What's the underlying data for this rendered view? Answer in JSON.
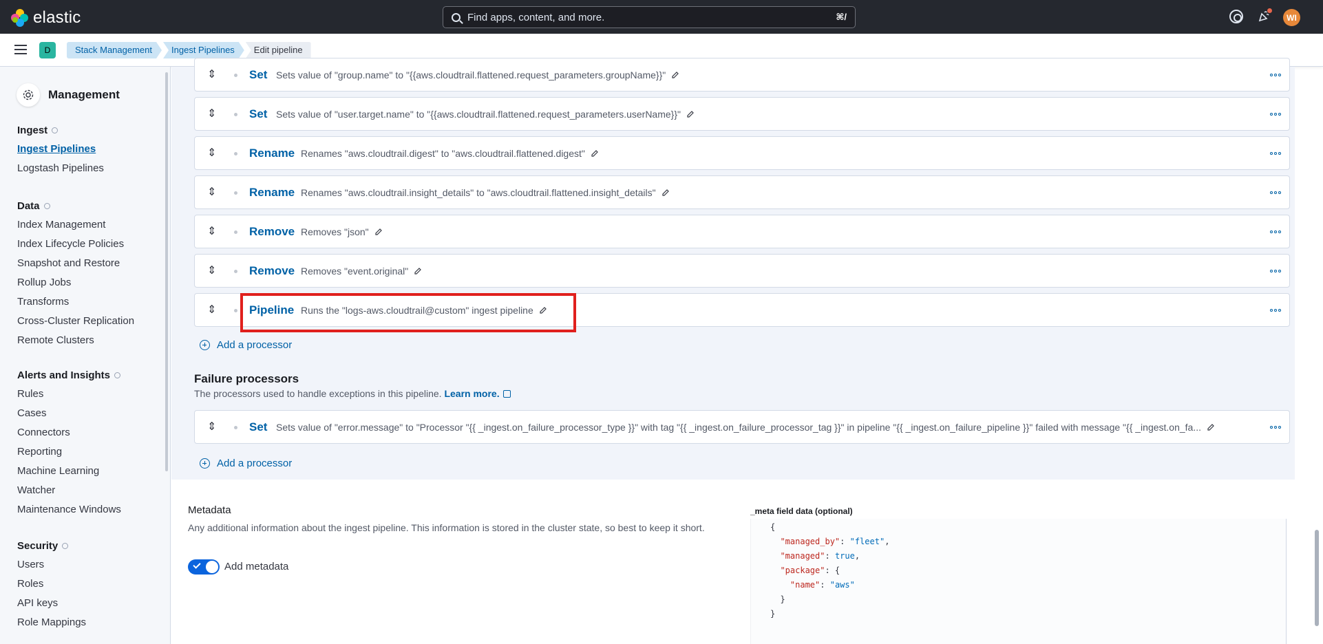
{
  "header": {
    "brand": "elastic",
    "search_placeholder": "Find apps, content, and more.",
    "search_shortcut": "⌘/",
    "avatar_initials": "WI"
  },
  "subheader": {
    "space_initial": "D",
    "breadcrumbs": [
      "Stack Management",
      "Ingest Pipelines",
      "Edit pipeline"
    ]
  },
  "sidebar": {
    "title": "Management",
    "groups": [
      {
        "title": "Ingest",
        "items": [
          "Ingest Pipelines",
          "Logstash Pipelines"
        ]
      },
      {
        "title": "Data",
        "items": [
          "Index Management",
          "Index Lifecycle Policies",
          "Snapshot and Restore",
          "Rollup Jobs",
          "Transforms",
          "Cross-Cluster Replication",
          "Remote Clusters"
        ]
      },
      {
        "title": "Alerts and Insights",
        "items": [
          "Rules",
          "Cases",
          "Connectors",
          "Reporting",
          "Machine Learning",
          "Watcher",
          "Maintenance Windows"
        ]
      },
      {
        "title": "Security",
        "items": [
          "Users",
          "Roles",
          "API keys",
          "Role Mappings"
        ]
      }
    ]
  },
  "processors": [
    {
      "type": "Set",
      "desc": "Sets value of \"group.name\" to \"{{aws.cloudtrail.flattened.request_parameters.groupName}}\""
    },
    {
      "type": "Set",
      "desc": "Sets value of \"user.target.name\" to \"{{aws.cloudtrail.flattened.request_parameters.userName}}\""
    },
    {
      "type": "Rename",
      "desc": "Renames \"aws.cloudtrail.digest\" to \"aws.cloudtrail.flattened.digest\""
    },
    {
      "type": "Rename",
      "desc": "Renames \"aws.cloudtrail.insight_details\" to \"aws.cloudtrail.flattened.insight_details\""
    },
    {
      "type": "Remove",
      "desc": "Removes \"json\""
    },
    {
      "type": "Remove",
      "desc": "Removes \"event.original\""
    },
    {
      "type": "Pipeline",
      "desc": "Runs the \"logs-aws.cloudtrail@custom\" ingest pipeline"
    }
  ],
  "add_processor_label": "Add a processor",
  "failure": {
    "title": "Failure processors",
    "description": "The processors used to handle exceptions in this pipeline.",
    "learn_more": "Learn more.",
    "processor": {
      "type": "Set",
      "desc": "Sets value of \"error.message\" to \"Processor \"{{ _ingest.on_failure_processor_type }}\" with tag \"{{ _ingest.on_failure_processor_tag }}\" in pipeline \"{{ _ingest.on_failure_pipeline }}\" failed with message \"{{ _ingest.on_fa..."
    }
  },
  "metadata": {
    "title": "Metadata",
    "description": "Any additional information about the ingest pipeline. This information is stored in the cluster state, so best to keep it short.",
    "toggle_label": "Add metadata",
    "toggle_on": true,
    "field_label": "_meta field data (optional)",
    "code": {
      "open": "{",
      "managed_by_key": "\"managed_by\"",
      "managed_by_val": "\"fleet\"",
      "managed_key": "\"managed\"",
      "managed_val": "true",
      "package_key": "\"package\"",
      "name_key": "\"name\"",
      "name_val": "\"aws\"",
      "inner_close": "}",
      "close": "}"
    }
  },
  "colors": {
    "accent": "#0061a6",
    "highlight": "#e0201d",
    "header_bg": "#25282f"
  }
}
